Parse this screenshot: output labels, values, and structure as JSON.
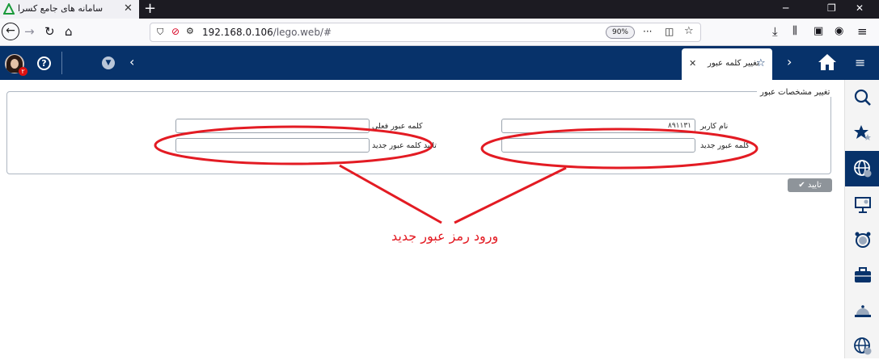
{
  "browser": {
    "tab_title": "سامانه های جامع کسرا",
    "url_host": "192.168.0.106",
    "url_path": "/lego.web/#",
    "zoom": "90%"
  },
  "app": {
    "badge_count": "۲",
    "active_tab_label": "تغییر کلمه عبور"
  },
  "form": {
    "legend": "تغییر مشخصات عبور",
    "username_label": "نام کاربر",
    "username_value": "۸۹۱۱۳۱",
    "new_password_label": "کلمه عبور جدید",
    "current_password_label": "کلمه عبور فعلی",
    "confirm_new_password_label": "تایید کلمه عبور جدید",
    "submit_label": "تایید"
  },
  "annotation": {
    "text": "ورود رمز عبور جدید",
    "color": "#e31b23"
  },
  "colors": {
    "header": "#07326a",
    "sidebar_active": "#07326a"
  }
}
